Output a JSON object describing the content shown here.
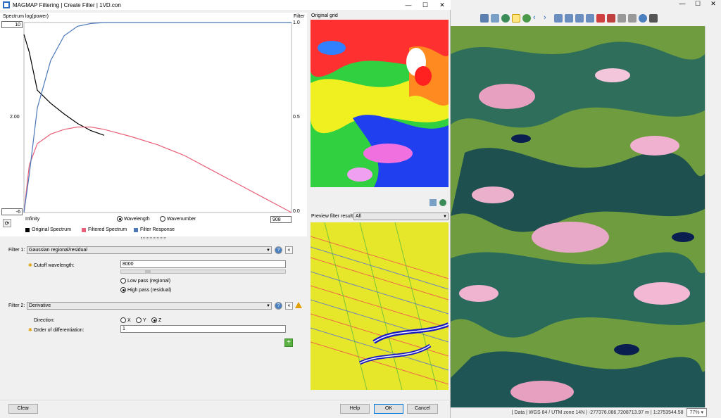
{
  "dialog": {
    "title": "MAGMAP Filtering | Create Filter | 1VD.con",
    "window_controls": [
      "—",
      "☐",
      "✕"
    ]
  },
  "chart": {
    "y_left_title": "Spectrum log(power)",
    "y_right_title": "Filter",
    "y_left_ticks": [
      "10",
      "2.00",
      "-6"
    ],
    "y_right_ticks": [
      "1.0",
      "0.5",
      "0.0"
    ],
    "x_left_label": "Infinity",
    "x_right_value": "908",
    "axis_mode": {
      "wavelength": "Wavelength",
      "wavenumber": "Wavenumber",
      "selected": "Wavelength"
    },
    "legend": [
      {
        "label": "Original Spectrum",
        "color": "#000000"
      },
      {
        "label": "Filtered Spectrum",
        "color": "#e8607a"
      },
      {
        "label": "Filter Response",
        "color": "#4a78b8"
      }
    ]
  },
  "chart_data": {
    "type": "line",
    "x": [
      0,
      0.02,
      0.05,
      0.1,
      0.15,
      0.2,
      0.25,
      0.3,
      0.4,
      0.5,
      0.6,
      0.7,
      0.8,
      0.9,
      1.0
    ],
    "series": [
      {
        "name": "Original Spectrum",
        "axis": "left",
        "values": [
          9,
          7.5,
          4.3,
          3.2,
          2.3,
          1.5,
          0.9,
          0.5,
          null,
          null,
          null,
          null,
          null,
          null,
          null
        ]
      },
      {
        "name": "Filtered Spectrum",
        "axis": "left",
        "values": [
          -6,
          -2,
          -0.2,
          0.6,
          1.0,
          1.2,
          1.2,
          1.0,
          0.4,
          -0.3,
          -1.2,
          -2.4,
          -3.6,
          -4.8,
          -6
        ]
      },
      {
        "name": "Filter Response",
        "axis": "right",
        "values": [
          0,
          0.2,
          0.55,
          0.8,
          0.93,
          0.98,
          0.995,
          1.0,
          1.0,
          1.0,
          1.0,
          1.0,
          1.0,
          1.0,
          1.0
        ]
      }
    ],
    "ylim_left": [
      -6,
      10
    ],
    "ylim_right": [
      0,
      1
    ]
  },
  "original_grid": {
    "label": "Original grid"
  },
  "preview": {
    "label": "Preview filter result:",
    "selected": "All"
  },
  "filter1": {
    "label": "Filter 1:",
    "type": "Gaussian regional/residual",
    "cutoff_label": "Cutoff wavelength:",
    "cutoff_value": "8000",
    "options": [
      "Low pass (regional)",
      "High pass (residual)"
    ],
    "selected": "High pass (residual)"
  },
  "filter2": {
    "label": "Filter 2:",
    "type": "Derivative",
    "direction_label": "Direction:",
    "directions": [
      "X",
      "Y",
      "Z"
    ],
    "selected_direction": "Z",
    "order_label": "Order of differentiation:",
    "order_value": "1"
  },
  "buttons": {
    "clear": "Clear",
    "help": "Help",
    "ok": "OK",
    "cancel": "Cancel"
  },
  "background_app": {
    "status_text": "| Data | WGS 84 / UTM zone 14N | -277376.086,7208713.97 m | 1:2753544.58",
    "zoom": "77%",
    "window_controls": [
      "—",
      "☐",
      "✕"
    ]
  }
}
